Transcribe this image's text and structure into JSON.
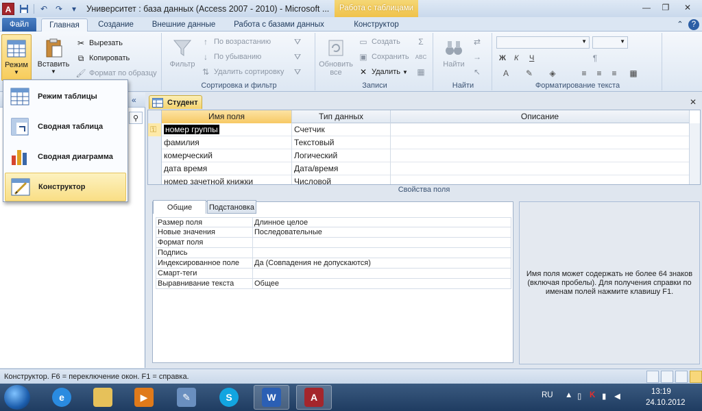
{
  "window": {
    "title": "Университет : база данных (Access 2007 - 2010)  -  Microsoft ...",
    "context_tab_header": "Работа с таблицами"
  },
  "tabs": {
    "file": "Файл",
    "home": "Главная",
    "create": "Создание",
    "external": "Внешние данные",
    "dbtools": "Работа с базами данных",
    "design": "Конструктор"
  },
  "ribbon": {
    "views": {
      "mode": "Режим"
    },
    "clipboard": {
      "paste": "Вставить",
      "cut": "Вырезать",
      "copy": "Копировать",
      "format_painter": "Формат по образцу"
    },
    "sort_filter": {
      "label": "Сортировка и фильтр",
      "filter": "Фильтр",
      "ascending": "По возрастанию",
      "descending": "По убыванию",
      "remove_sort": "Удалить сортировку"
    },
    "records": {
      "label": "Записи",
      "refresh": "Обновить",
      "refresh2": "все",
      "new": "Создать",
      "save": "Сохранить",
      "delete": "Удалить"
    },
    "find": {
      "label": "Найти",
      "find": "Найти"
    },
    "text_format": {
      "label": "Форматирование текста",
      "bold": "Ж",
      "italic": "К",
      "underline": "Ч"
    }
  },
  "dropdown": {
    "items": [
      {
        "label": "Режим таблицы"
      },
      {
        "label": "Сводная таблица"
      },
      {
        "label": "Сводная диаграмма"
      },
      {
        "label": "Конструктор"
      }
    ]
  },
  "document": {
    "tab_label": "Студент",
    "columns": [
      "Имя поля",
      "Тип данных",
      "Описание"
    ],
    "rows": [
      {
        "name": "номер группы",
        "type": "Счетчик"
      },
      {
        "name": "фамилия",
        "type": "Текстовый"
      },
      {
        "name": "комерческий",
        "type": "Логический"
      },
      {
        "name": "дата время",
        "type": "Дата/время"
      },
      {
        "name": "номер зачетной книжки",
        "type": "Числовой"
      }
    ],
    "props_title": "Свойства поля",
    "props_tabs": [
      "Общие",
      "Подстановка"
    ],
    "properties": [
      {
        "name": "Размер поля",
        "value": "Длинное целое"
      },
      {
        "name": "Новые значения",
        "value": "Последовательные"
      },
      {
        "name": "Формат поля",
        "value": ""
      },
      {
        "name": "Подпись",
        "value": ""
      },
      {
        "name": "Индексированное поле",
        "value": "Да (Совпадения не допускаются)"
      },
      {
        "name": "Смарт-теги",
        "value": ""
      },
      {
        "name": "Выравнивание текста",
        "value": "Общее"
      }
    ],
    "help_text": "Имя поля может содержать не более 64 знаков (включая пробелы). Для получения справки по именам полей нажмите клавишу F1."
  },
  "statusbar": {
    "text": "Конструктор.  F6 = переключение окон.  F1 = справка."
  },
  "taskbar": {
    "lang": "RU",
    "time": "13:19",
    "date": "24.10.2012",
    "word_label": "W"
  },
  "colors": {
    "accent": "#f0c24a",
    "file_tab": "#2c5fa6",
    "selection": "#f9de85"
  }
}
